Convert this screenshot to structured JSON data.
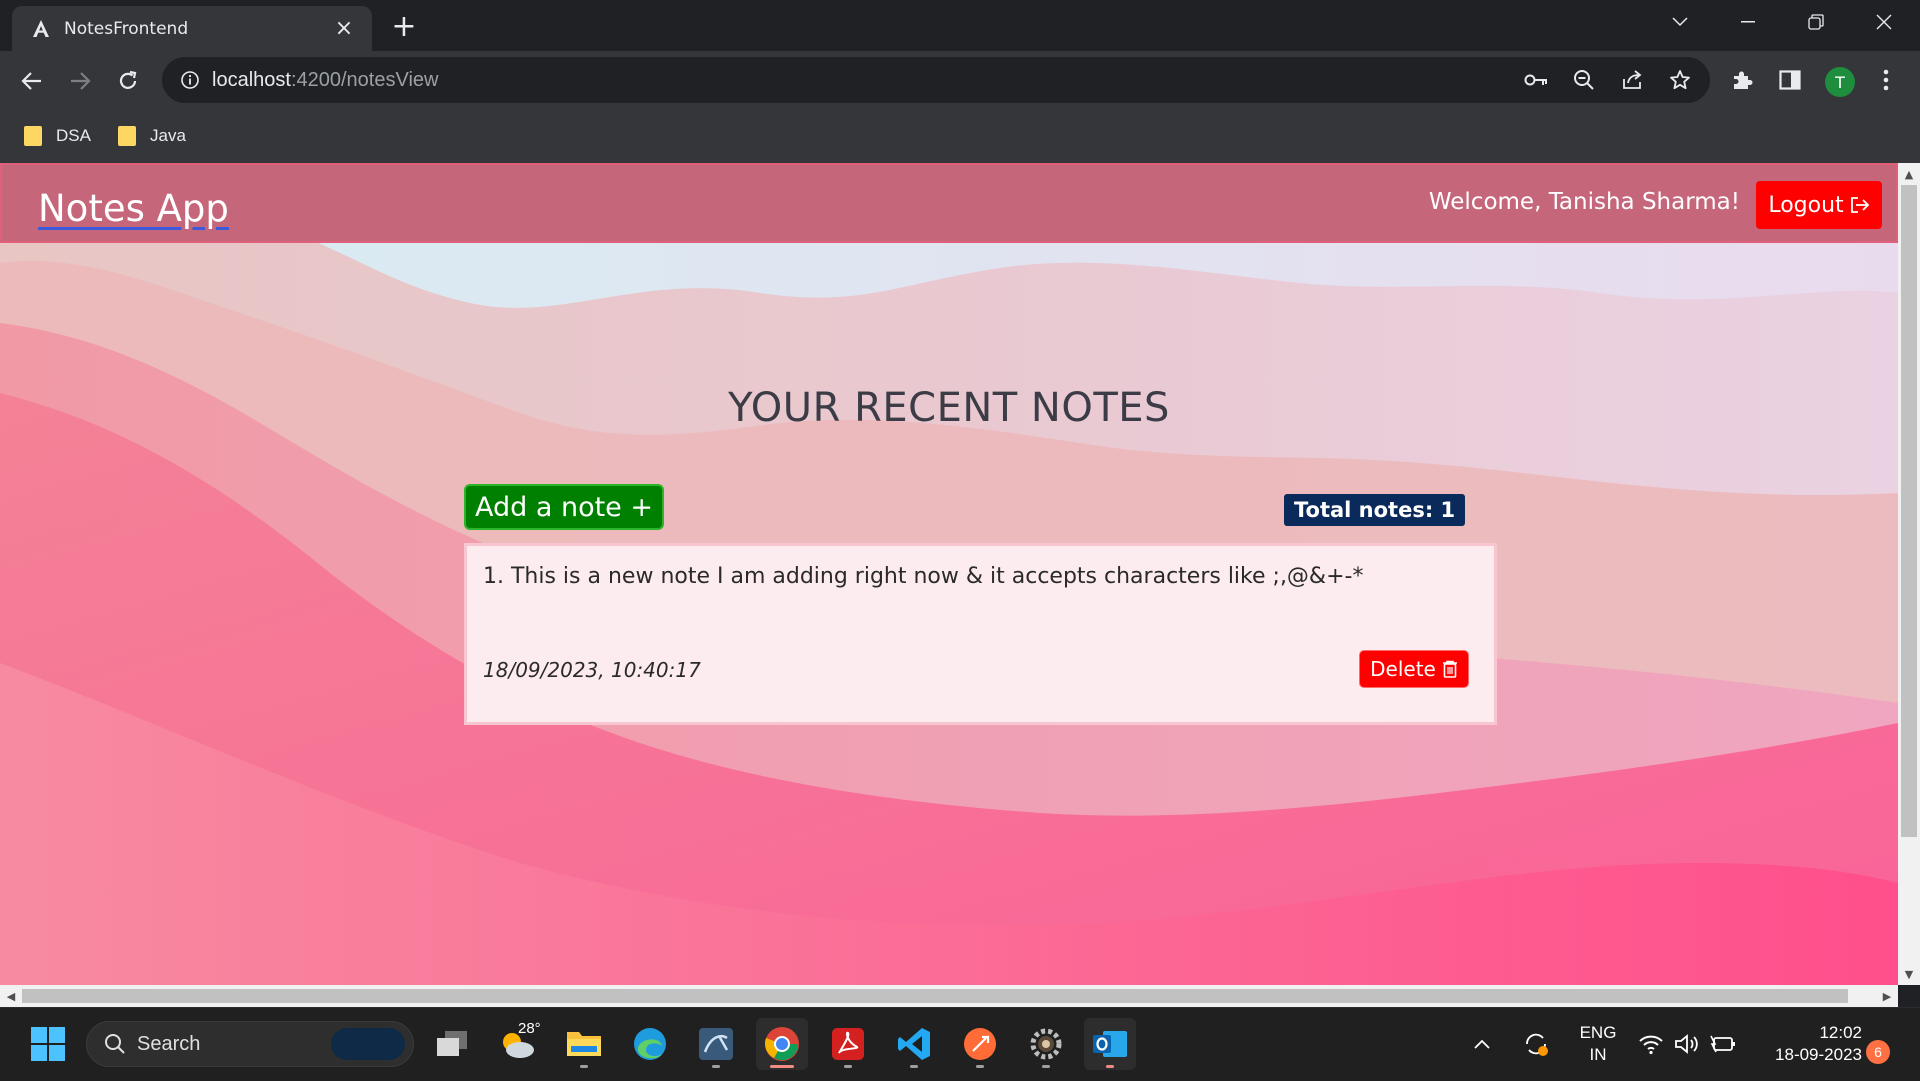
{
  "browser": {
    "tab_title": "NotesFrontend",
    "url_host": "localhost",
    "url_path": ":4200/notesView",
    "profile_initial": "T",
    "bookmarks": [
      "DSA",
      "Java"
    ]
  },
  "app": {
    "brand": "Notes App",
    "welcome": "Welcome, Tanisha Sharma!",
    "logout_label": "Logout",
    "heading": "YOUR RECENT NOTES",
    "add_note_label": "Add a note +",
    "total_notes_label": "Total notes: 1",
    "notes": [
      {
        "text": "1. This is a new note I am adding right now & it accepts characters like ;,@&+-*",
        "timestamp": "18/09/2023, 10:40:17",
        "delete_label": "Delete"
      }
    ],
    "colors": {
      "navbar": "#c6667b",
      "logout": "#ff0000",
      "add_note": "#008000",
      "total_badge": "#0b2a5c",
      "delete": "#ff0000"
    }
  },
  "taskbar": {
    "search_label": "Search",
    "weather_temp": "28°",
    "lang_primary": "ENG",
    "lang_secondary": "IN",
    "time": "12:02",
    "date": "18-09-2023",
    "notification_count": "6"
  }
}
